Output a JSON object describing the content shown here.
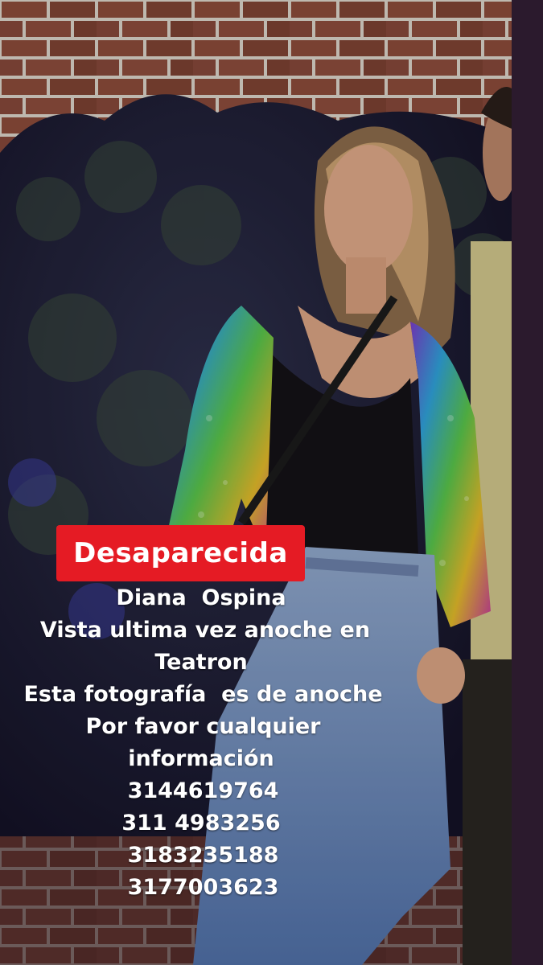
{
  "poster": {
    "badge": "Desaparecida",
    "lines": [
      "Diana  Ospina",
      "Vista ultima vez anoche en",
      "Teatron",
      "Esta fotografía  es de anoche",
      "Por favor cualquier",
      "información",
      "3144619764",
      "311 4983256",
      "3183235188",
      "3177003623"
    ]
  },
  "colors": {
    "badge_background": "#e51b24",
    "text": "#ffffff"
  }
}
